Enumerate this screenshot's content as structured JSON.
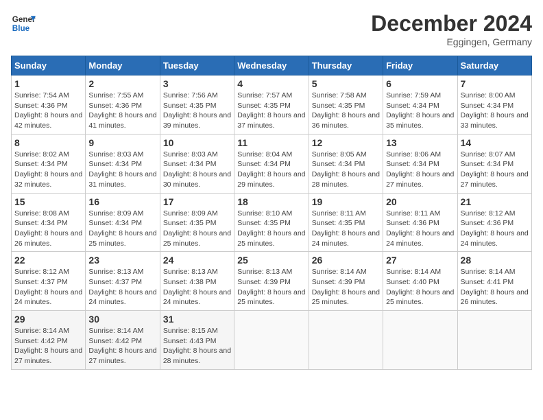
{
  "header": {
    "logo_text_general": "General",
    "logo_text_blue": "Blue",
    "month_title": "December 2024",
    "location": "Eggingen, Germany"
  },
  "calendar": {
    "days_of_week": [
      "Sunday",
      "Monday",
      "Tuesday",
      "Wednesday",
      "Thursday",
      "Friday",
      "Saturday"
    ],
    "weeks": [
      [
        {
          "day": "1",
          "info": "Sunrise: 7:54 AM\nSunset: 4:36 PM\nDaylight: 8 hours and 42 minutes."
        },
        {
          "day": "2",
          "info": "Sunrise: 7:55 AM\nSunset: 4:36 PM\nDaylight: 8 hours and 41 minutes."
        },
        {
          "day": "3",
          "info": "Sunrise: 7:56 AM\nSunset: 4:35 PM\nDaylight: 8 hours and 39 minutes."
        },
        {
          "day": "4",
          "info": "Sunrise: 7:57 AM\nSunset: 4:35 PM\nDaylight: 8 hours and 37 minutes."
        },
        {
          "day": "5",
          "info": "Sunrise: 7:58 AM\nSunset: 4:35 PM\nDaylight: 8 hours and 36 minutes."
        },
        {
          "day": "6",
          "info": "Sunrise: 7:59 AM\nSunset: 4:34 PM\nDaylight: 8 hours and 35 minutes."
        },
        {
          "day": "7",
          "info": "Sunrise: 8:00 AM\nSunset: 4:34 PM\nDaylight: 8 hours and 33 minutes."
        }
      ],
      [
        {
          "day": "8",
          "info": "Sunrise: 8:02 AM\nSunset: 4:34 PM\nDaylight: 8 hours and 32 minutes."
        },
        {
          "day": "9",
          "info": "Sunrise: 8:03 AM\nSunset: 4:34 PM\nDaylight: 8 hours and 31 minutes."
        },
        {
          "day": "10",
          "info": "Sunrise: 8:03 AM\nSunset: 4:34 PM\nDaylight: 8 hours and 30 minutes."
        },
        {
          "day": "11",
          "info": "Sunrise: 8:04 AM\nSunset: 4:34 PM\nDaylight: 8 hours and 29 minutes."
        },
        {
          "day": "12",
          "info": "Sunrise: 8:05 AM\nSunset: 4:34 PM\nDaylight: 8 hours and 28 minutes."
        },
        {
          "day": "13",
          "info": "Sunrise: 8:06 AM\nSunset: 4:34 PM\nDaylight: 8 hours and 27 minutes."
        },
        {
          "day": "14",
          "info": "Sunrise: 8:07 AM\nSunset: 4:34 PM\nDaylight: 8 hours and 27 minutes."
        }
      ],
      [
        {
          "day": "15",
          "info": "Sunrise: 8:08 AM\nSunset: 4:34 PM\nDaylight: 8 hours and 26 minutes."
        },
        {
          "day": "16",
          "info": "Sunrise: 8:09 AM\nSunset: 4:34 PM\nDaylight: 8 hours and 25 minutes."
        },
        {
          "day": "17",
          "info": "Sunrise: 8:09 AM\nSunset: 4:35 PM\nDaylight: 8 hours and 25 minutes."
        },
        {
          "day": "18",
          "info": "Sunrise: 8:10 AM\nSunset: 4:35 PM\nDaylight: 8 hours and 25 minutes."
        },
        {
          "day": "19",
          "info": "Sunrise: 8:11 AM\nSunset: 4:35 PM\nDaylight: 8 hours and 24 minutes."
        },
        {
          "day": "20",
          "info": "Sunrise: 8:11 AM\nSunset: 4:36 PM\nDaylight: 8 hours and 24 minutes."
        },
        {
          "day": "21",
          "info": "Sunrise: 8:12 AM\nSunset: 4:36 PM\nDaylight: 8 hours and 24 minutes."
        }
      ],
      [
        {
          "day": "22",
          "info": "Sunrise: 8:12 AM\nSunset: 4:37 PM\nDaylight: 8 hours and 24 minutes."
        },
        {
          "day": "23",
          "info": "Sunrise: 8:13 AM\nSunset: 4:37 PM\nDaylight: 8 hours and 24 minutes."
        },
        {
          "day": "24",
          "info": "Sunrise: 8:13 AM\nSunset: 4:38 PM\nDaylight: 8 hours and 24 minutes."
        },
        {
          "day": "25",
          "info": "Sunrise: 8:13 AM\nSunset: 4:39 PM\nDaylight: 8 hours and 25 minutes."
        },
        {
          "day": "26",
          "info": "Sunrise: 8:14 AM\nSunset: 4:39 PM\nDaylight: 8 hours and 25 minutes."
        },
        {
          "day": "27",
          "info": "Sunrise: 8:14 AM\nSunset: 4:40 PM\nDaylight: 8 hours and 25 minutes."
        },
        {
          "day": "28",
          "info": "Sunrise: 8:14 AM\nSunset: 4:41 PM\nDaylight: 8 hours and 26 minutes."
        }
      ],
      [
        {
          "day": "29",
          "info": "Sunrise: 8:14 AM\nSunset: 4:42 PM\nDaylight: 8 hours and 27 minutes."
        },
        {
          "day": "30",
          "info": "Sunrise: 8:14 AM\nSunset: 4:42 PM\nDaylight: 8 hours and 27 minutes."
        },
        {
          "day": "31",
          "info": "Sunrise: 8:15 AM\nSunset: 4:43 PM\nDaylight: 8 hours and 28 minutes."
        },
        null,
        null,
        null,
        null
      ]
    ]
  }
}
